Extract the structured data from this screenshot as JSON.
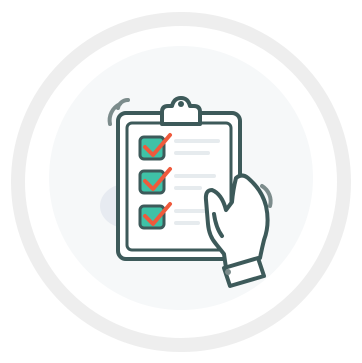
{
  "illustration": {
    "subject": "clipboard-checklist-held-in-hand",
    "checklist_items": [
      {
        "checked": true
      },
      {
        "checked": true
      },
      {
        "checked": true
      }
    ],
    "colors": {
      "ring": "#eeeeee",
      "inner_disc": "#f6f8f9",
      "outline": "#3d5a5a",
      "check_box_fill": "#3fc2a7",
      "check_mark": "#ef5a3c",
      "list_line": "#e6ebee",
      "hand_fill": "#ffffff",
      "accent_dot": "#7c8c8c",
      "shadow_blob": "#e7ebf1"
    }
  }
}
